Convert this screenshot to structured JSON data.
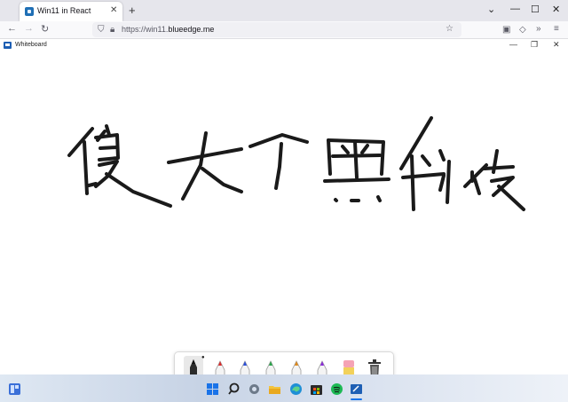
{
  "browser": {
    "tab_title": "Win11 in React",
    "url_prefix": "https://win11.",
    "url_domain": "blueedge.me"
  },
  "app": {
    "title": "Whiteboard"
  },
  "whiteboard": {
    "handwriting": "傻大个黑科技",
    "pen_colors": [
      "#222222",
      "#d92a2a",
      "#2a4fd9",
      "#2aa34a",
      "#e08a1c",
      "#8a2ad9"
    ]
  },
  "taskbar": {
    "icons": [
      "widgets-icon",
      "start-icon",
      "search-icon",
      "settings-icon",
      "file-explorer-icon",
      "edge-icon",
      "store-icon",
      "spotify-icon",
      "whiteboard-icon"
    ]
  }
}
